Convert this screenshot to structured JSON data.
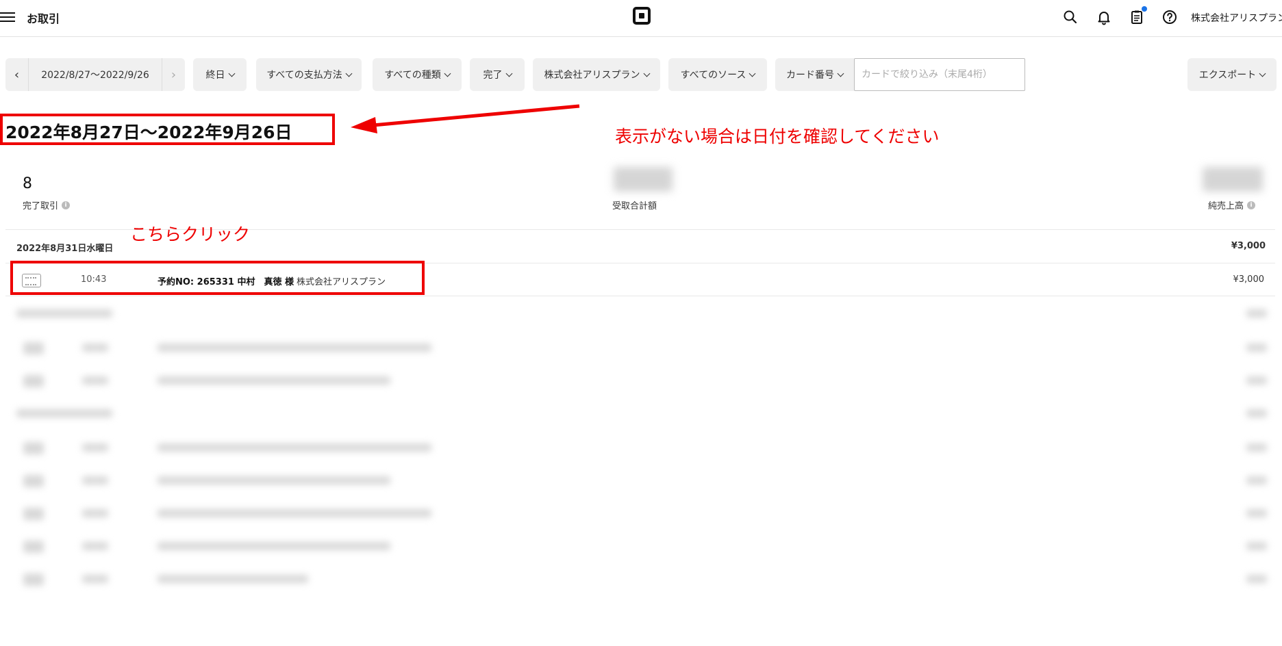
{
  "header": {
    "app_title": "お取引",
    "account_name": "株式会社アリスプラン"
  },
  "filters": {
    "date_range": "2022/8/27～2022/9/26",
    "time": "終日",
    "payment_method": "すべての支払方法",
    "type": "すべての種類",
    "status": "完了",
    "location": "株式会社アリスプラン",
    "source": "すべてのソース",
    "card_number_label": "カード番号",
    "card_filter_placeholder": "カードで絞り込み（末尾4桁）",
    "export": "エクスポート"
  },
  "range_title": "2022年8月27日～2022年9月26日",
  "annotations": {
    "date_note": "表示がない場合は日付を確認してください",
    "click_note": "こちらクリック"
  },
  "summary": {
    "completed_count": "8",
    "completed_label": "完了取引",
    "received_label": "受取合計額",
    "net_sales_label": "純売上高"
  },
  "day": {
    "date_label": "2022年8月31日水曜日",
    "total": "¥3,000"
  },
  "transaction": {
    "time": "10:43",
    "description": "予約NO: 265331 中村　真徳 様",
    "merchant": "株式会社アリスプラン",
    "amount": "¥3,000"
  },
  "colors": {
    "annotation_red": "#e00000",
    "notification_dot": "#1a73e8"
  }
}
